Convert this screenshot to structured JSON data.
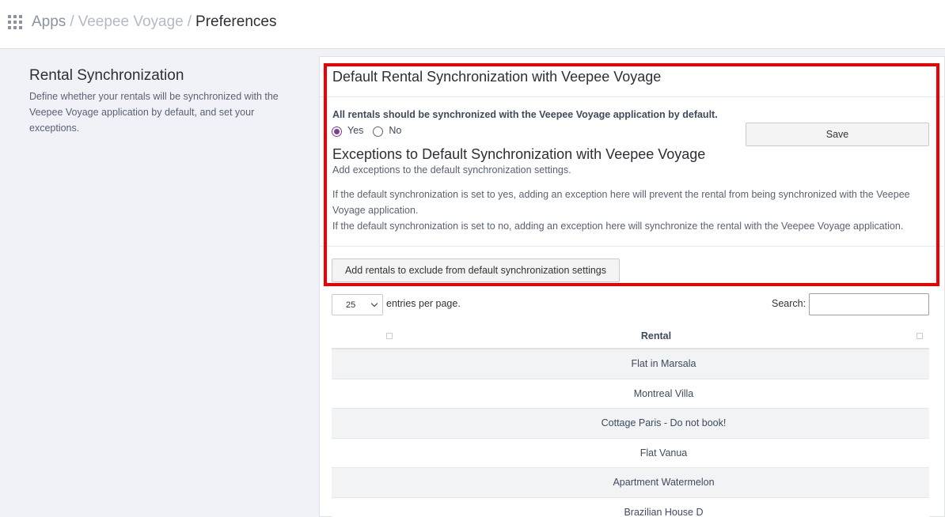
{
  "breadcrumb": {
    "apps": "Apps",
    "app": "Veepee Voyage",
    "current": "Preferences",
    "separator": "/"
  },
  "section": {
    "title": "Rental Synchronization",
    "description": "Define whether your rentals will be synchronized with the Veepee Voyage application by default, and set your exceptions."
  },
  "panel": {
    "title": "Default Rental Synchronization with Veepee Voyage",
    "question": "All rentals should be synchronized with the Veepee Voyage application by default.",
    "options": [
      {
        "label": "Yes",
        "checked": true
      },
      {
        "label": "No",
        "checked": false
      }
    ],
    "save_label": "Save",
    "exceptions_title": "Exceptions to Default Synchronization with Veepee Voyage",
    "exceptions_subtitle": "Add exceptions to the default synchronization settings.",
    "exceptions_yes": "If the default synchronization is set to yes, adding an exception here will prevent the rental from being synchronized with the Veepee Voyage application.",
    "exceptions_no": "If the default synchronization is set to no, adding an exception here will synchronize the rental with the Veepee Voyage application.",
    "add_button_label": "Add rentals to exclude from default synchronization settings"
  },
  "table": {
    "per_page_value": "25",
    "per_page_label": "entries per page.",
    "search_label": "Search:",
    "search_value": "",
    "column_header": "Rental",
    "rows": [
      "Flat in Marsala",
      "Montreal Villa",
      "Cottage Paris - Do not book!",
      "Flat Vanua",
      "Apartment Watermelon",
      "Brazilian House D"
    ]
  },
  "colors": {
    "highlight": "#ee0000",
    "radio_accent": "#7b3f8c"
  }
}
